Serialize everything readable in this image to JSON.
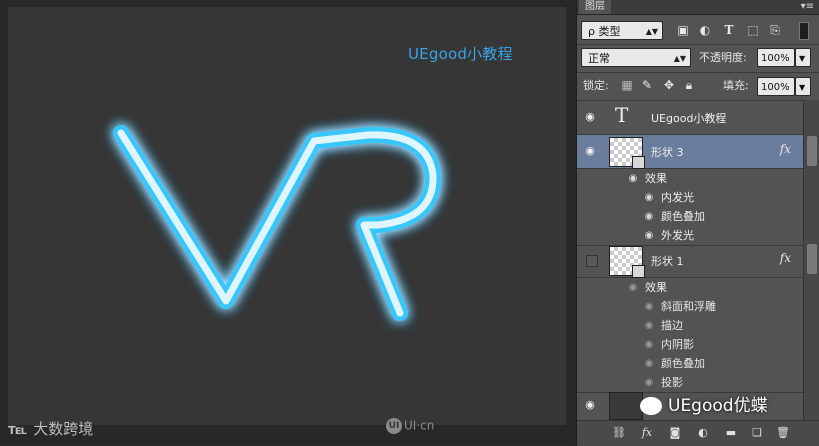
{
  "canvas": {
    "title_text": "UEgood小教程",
    "watermark_left": "大数跨境",
    "watermark_left_logo": "℡",
    "watermark_mid": "UI·cn",
    "watermark_mid_circle": "UI",
    "neon_color": "#37c6ff"
  },
  "panel": {
    "tab_label": "图层",
    "tab_menu": "▾≡",
    "filter_kind": "ρ 类型",
    "blend_mode": "正常",
    "opacity_label": "不透明度:",
    "opacity_value": "100%",
    "lock_label": "锁定:",
    "fill_label": "填充:",
    "fill_value": "100%"
  },
  "layers": [
    {
      "name": "UEgood小教程",
      "type": "text",
      "visible": true
    },
    {
      "name": "形状 3",
      "type": "shape",
      "visible": true,
      "selected": true,
      "fx": "fx",
      "effects_label": "效果",
      "effects": [
        "内发光",
        "颜色叠加",
        "外发光"
      ]
    },
    {
      "name": "形状 1",
      "type": "shape",
      "visible": false,
      "fx": "fx",
      "effects_label": "效果",
      "effects": [
        "斜面和浮雕",
        "描边",
        "内阴影",
        "颜色叠加",
        "投影"
      ]
    }
  ],
  "overlay_watermark": "UEgood优蝶",
  "bottom_icons": [
    "link-icon",
    "fx-icon",
    "mask-icon",
    "adjustment-icon",
    "folder-icon",
    "new-layer-icon",
    "trash-icon"
  ]
}
